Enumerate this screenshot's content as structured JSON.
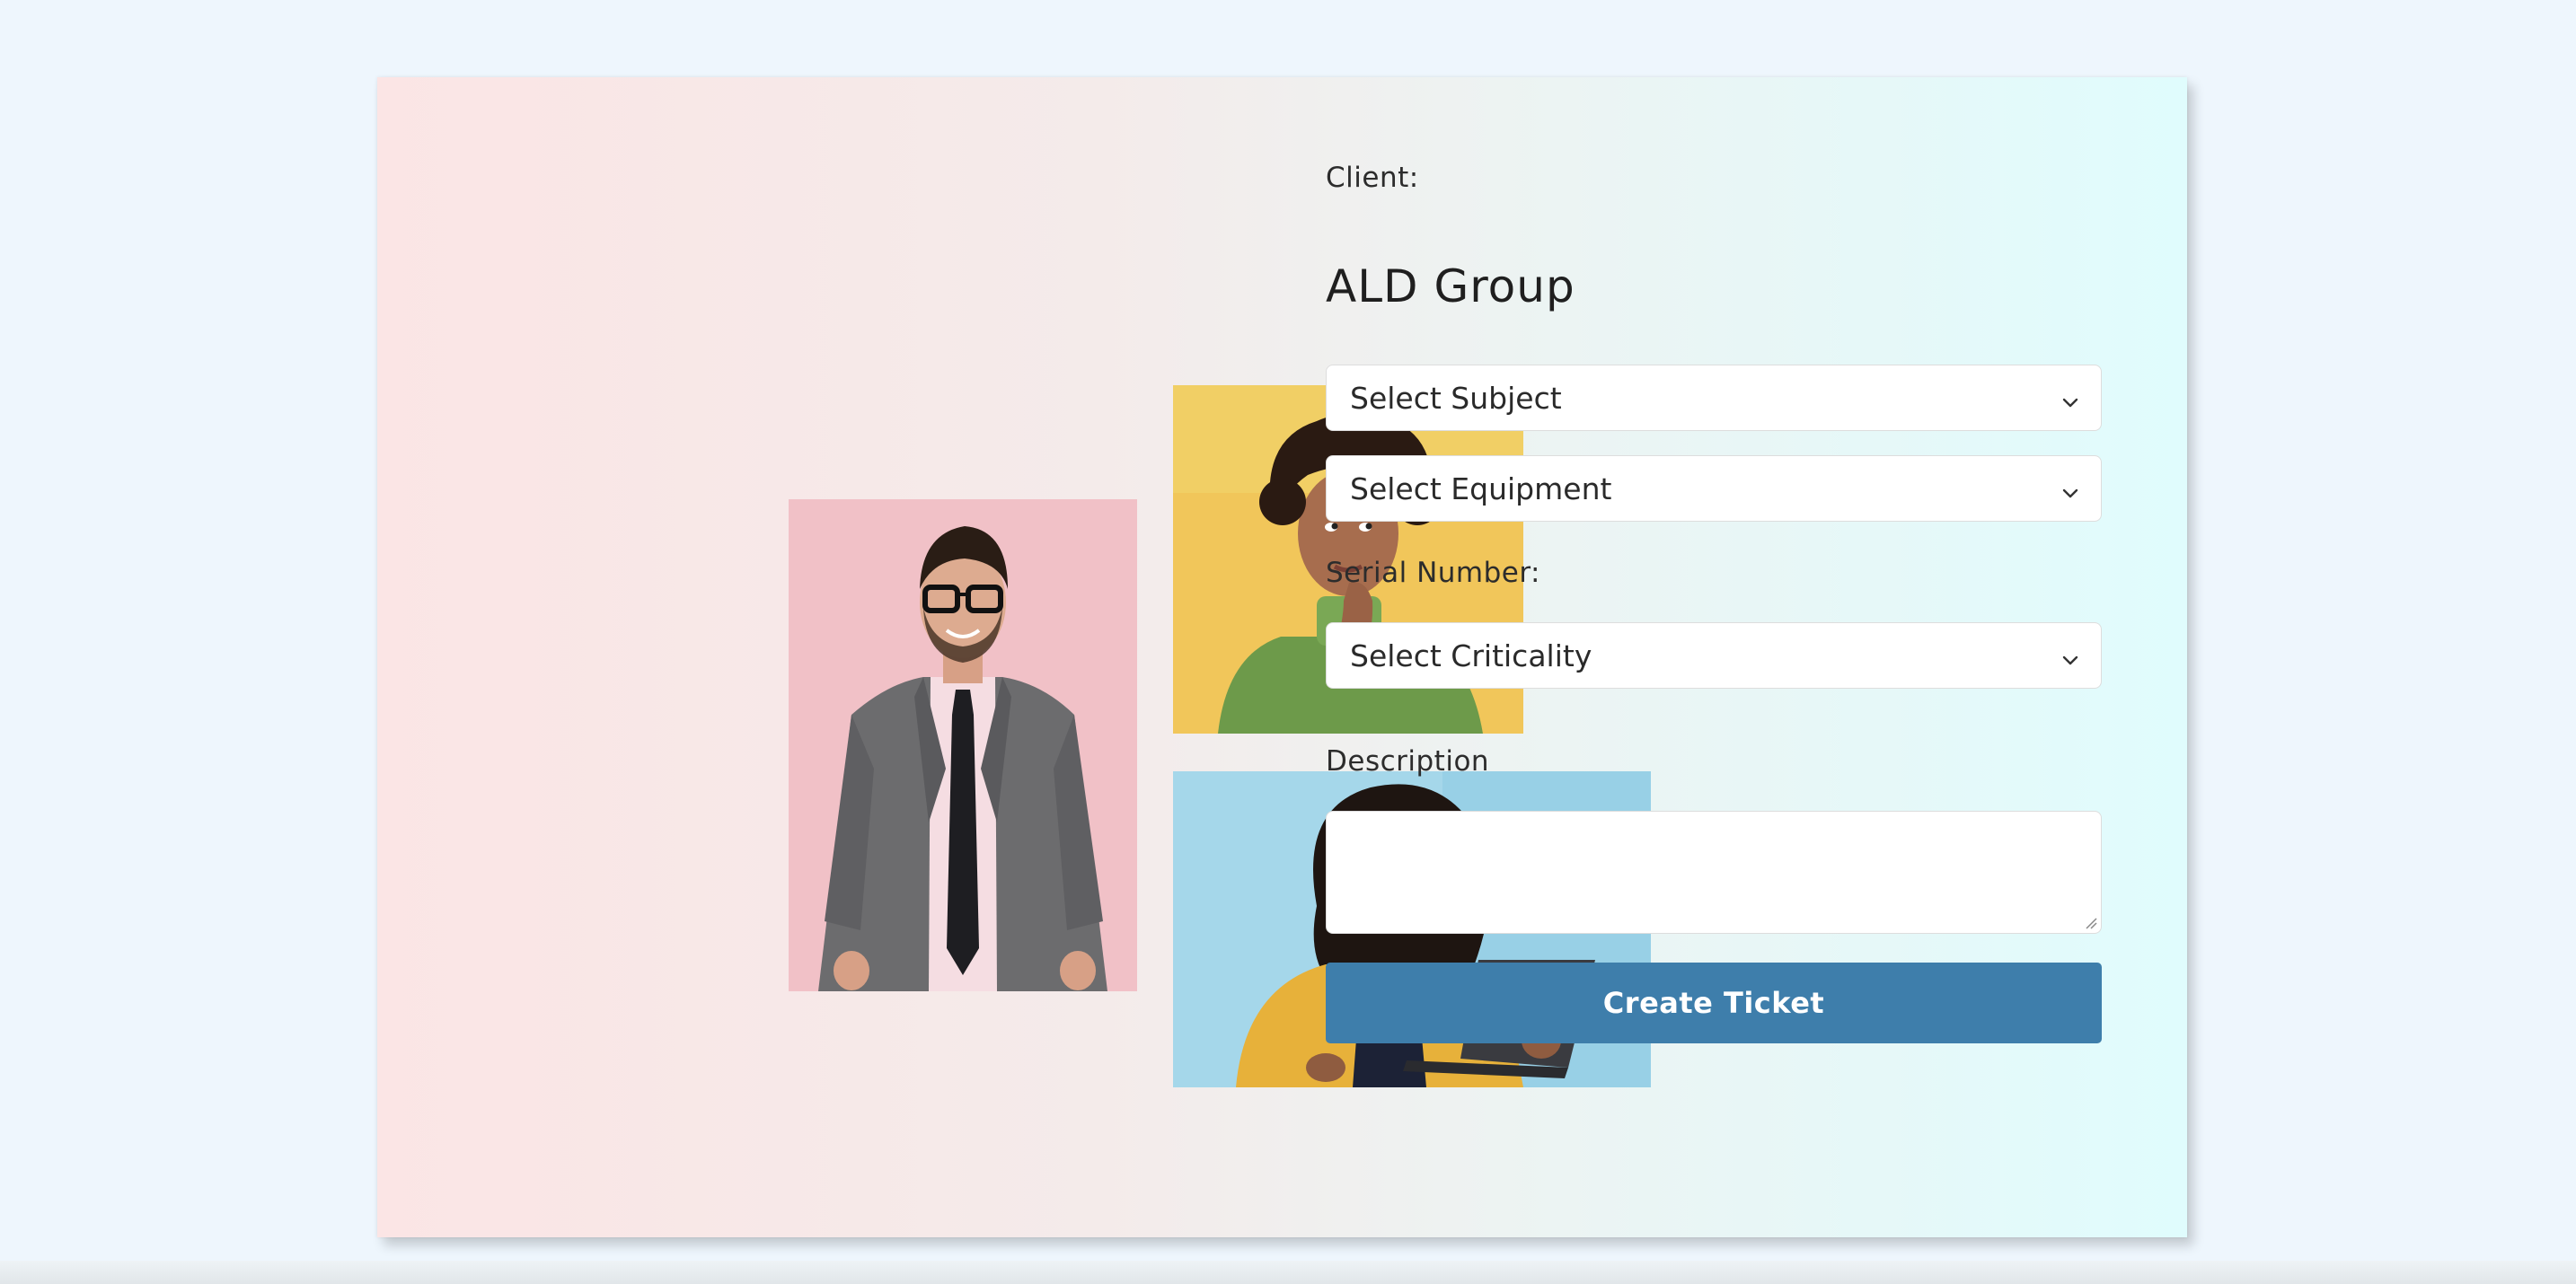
{
  "form": {
    "client_label": "Client:",
    "client_name": "ALD Group",
    "subject_select": "Select Subject",
    "equipment_select": "Select Equipment",
    "serial_label": "Serial Number:",
    "criticality_select": "Select Criticality",
    "description_label": "Description",
    "description_value": "",
    "submit_label": "Create Ticket"
  },
  "colors": {
    "page_background": "#eef6fd",
    "button": "#3e7eab",
    "card_gradient_start": "#fbe5e5",
    "card_gradient_end": "#e0fcfd"
  },
  "icons": {
    "select_chevron": "chevron-down-icon",
    "textarea_resize": "resize-grip-icon"
  }
}
